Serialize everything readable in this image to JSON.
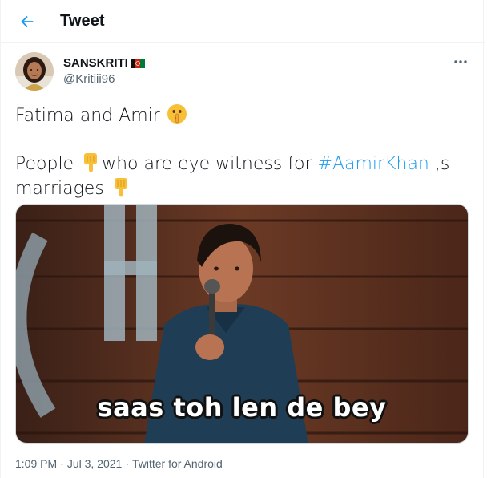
{
  "header": {
    "title": "Tweet",
    "back_icon": "arrow-left-icon"
  },
  "author": {
    "display_name": "SANSKRITI",
    "handle": "@Kritiii96",
    "flag_icon": "afghanistan-flag-icon"
  },
  "tweet": {
    "line1_text": "Fatima and Amir ",
    "line1_emoji": "shushing-face-icon",
    "line2_pre": "People ",
    "line2_mid": "who are eye witness for ",
    "hashtag": "#AamirKhan",
    "line2_post": " ,s",
    "line3_text": "marriages ",
    "pointing_emoji": "backhand-index-pointing-down-icon"
  },
  "media": {
    "caption": "saas toh len de bey"
  },
  "meta": {
    "time": "1:09 PM",
    "separator": "·",
    "date": "Jul 3, 2021",
    "source": "Twitter for Android"
  },
  "colors": {
    "accent": "#1d9bf0",
    "text": "#0f1419",
    "secondary": "#536471",
    "border": "#eff3f4"
  }
}
